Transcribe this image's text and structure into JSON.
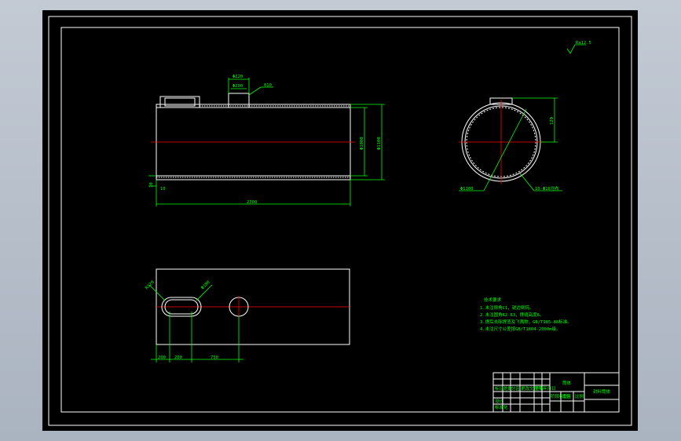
{
  "drawing": {
    "roughness_mark": "Ra12.5",
    "front_view": {
      "dim_top_width": "Φ220",
      "dim_hole": "Φ200",
      "dim_thickness": "δ10",
      "dim_inner_dia": "Φ1080",
      "dim_outer_dia": "Φ1100",
      "dim_length": "2300",
      "dim_left_a": "10",
      "dim_left_b": "10"
    },
    "side_view": {
      "dim_height": "120",
      "leader_left": "Φ1100",
      "leader_right": "10-Φ16均布"
    },
    "plan_view": {
      "dim_slot_width": "R120",
      "dim_hole_dia": "Φ180",
      "dim_a": "200",
      "dim_b": "200",
      "dim_c": "750"
    },
    "notes": {
      "title": "技术要求",
      "lines": [
        "1.未注倒角C1，锐边倒钝。",
        "2.未注圆角R2-R3，焊缝高度6。",
        "3.焊后去除焊渣及飞溅物，GB/T985-88标准。",
        "4.未注尺寸公差按GB/T1804-2000m级。"
      ]
    },
    "title_block": {
      "part_name": "筒体",
      "drawing_no": "封料筒体",
      "row_labels": [
        "标记",
        "处数",
        "分区",
        "更改文件号",
        "签名",
        "年月日"
      ],
      "cells": [
        "设计",
        "标准化",
        "阶段标记",
        "重量",
        "比例"
      ]
    }
  }
}
